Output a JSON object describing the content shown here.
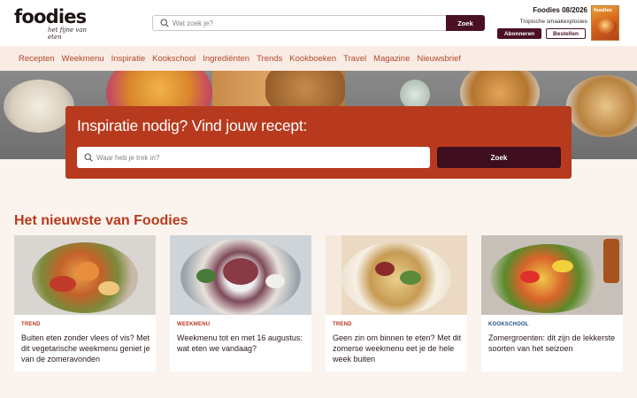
{
  "brand": {
    "logo_word": "foodies",
    "logo_tagline": "het fijne van eten"
  },
  "search": {
    "placeholder": "Wat zoek je?",
    "button_label": "Zoek"
  },
  "magazine": {
    "title": "Foodies 08/2026",
    "subtitle": "Tropische smaakexplosies",
    "subscribe_label": "Abonneren",
    "order_label": "Bestellen",
    "cover_title": "foodies"
  },
  "nav": {
    "items": [
      "Recepten",
      "Weekmenu",
      "Inspiratie",
      "Kookschool",
      "Ingrediënten",
      "Trends",
      "Kookboeken",
      "Travel",
      "Magazine",
      "Nieuwsbrief"
    ]
  },
  "hero": {
    "title": "Inspiratie nodig? Vind jouw recept:",
    "search_placeholder": "Waar heb je trek in?",
    "button_label": "Zoek"
  },
  "latest": {
    "title": "Het nieuwste van Foodies",
    "cards": [
      {
        "tag": "TREND",
        "tag_color": "#b83a1e",
        "text": "Buiten eten zonder vlees of vis? Met dit vegetarische weekmenu geniet je van de zomeravonden",
        "image": "grilled-vegetables-plate"
      },
      {
        "tag": "WEEKMENU",
        "tag_color": "#b83a1e",
        "text": "Weekmenu tot en met 16 augustus: wat eten we vandaag?",
        "image": "beef-salad-plate"
      },
      {
        "tag": "TREND",
        "tag_color": "#b83a1e",
        "text": "Geen zin om binnen te eten? Met dit zomerse weekmenu eet je de hele week buiten",
        "image": "pasta-salad-bowl"
      },
      {
        "tag": "KOOKSCHOOL",
        "tag_color": "#1e4a8a",
        "text": "Zomergroenten: dit zijn de lekkerste soorten van het seizoen",
        "image": "grilled-summer-vegetables"
      }
    ]
  },
  "colors": {
    "brand_red": "#b83a1e",
    "dark_plum": "#4a1024",
    "nav_bg": "#f8ece4",
    "page_bg": "#fbf4ee"
  }
}
